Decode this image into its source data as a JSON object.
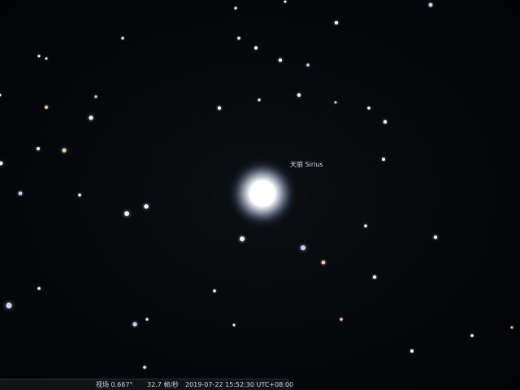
{
  "sky": {
    "object_label": "天狼 Sirius",
    "colors": {
      "background": "#05080a",
      "bright_star": "#ffffff",
      "star_white": "#f2f6ff",
      "star_blue": "#bcd6ff",
      "star_orange": "#ffc58a"
    }
  },
  "status_bar": {
    "fov": "视场 0.667°",
    "fps": "32.7 帧/秒",
    "datetime": "2019-07-22 15:52:30 UTC+08:00"
  }
}
